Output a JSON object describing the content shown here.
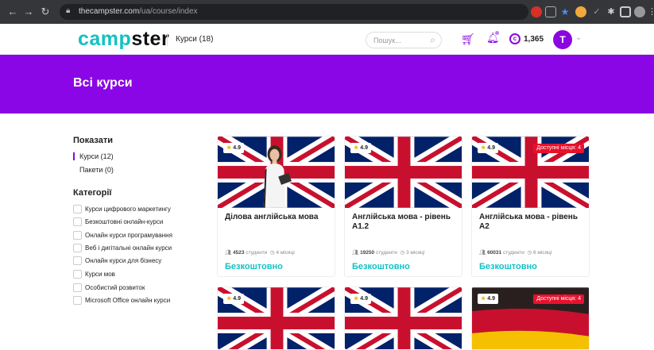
{
  "browser": {
    "url_host": "thecampster.com",
    "url_path": "/ua/course/index"
  },
  "header": {
    "logo_part1": "camp",
    "logo_part2": "ster",
    "courses_link": "Курси (18)",
    "search_placeholder": "Пошук...",
    "coins": "1,365",
    "avatar_letter": "T"
  },
  "hero": {
    "title": "Всі курси"
  },
  "sidebar": {
    "show_title": "Показати",
    "show_items": [
      "Курси (12)",
      "Пакети (0)"
    ],
    "categories_title": "Категорії",
    "categories": [
      "Курси цифрового маркетингу",
      "Безкоштовні онлайн-курси",
      "Онлайн курси програмування",
      "Веб і дигітальні онлайн курси",
      "Онлайн курси для бізнесу",
      "Курси мов",
      "Особистий розвиток",
      "Microsoft Office онлайн курси"
    ]
  },
  "courses": [
    {
      "rating": "4.9",
      "title": "Ділова англійська мова",
      "students": "4523",
      "students_label": "студенти",
      "duration": "4 місяці",
      "price": "Безкоштовно",
      "spots": ""
    },
    {
      "rating": "4.9",
      "title": "Англійська мова - рівень А1.2",
      "students": "19250",
      "students_label": "студенти",
      "duration": "3 місяці",
      "price": "Безкоштовно",
      "spots": ""
    },
    {
      "rating": "4.9",
      "title": "Англійська мова - рівень А2",
      "students": "60031",
      "students_label": "студенти",
      "duration": "6 місяці",
      "price": "Безкоштовно",
      "spots": "Доступні місця: 4"
    },
    {
      "rating": "4.9",
      "spots": ""
    },
    {
      "rating": "4.9",
      "spots": ""
    },
    {
      "rating": "4.9",
      "spots": "Доступні місця: 4"
    }
  ]
}
